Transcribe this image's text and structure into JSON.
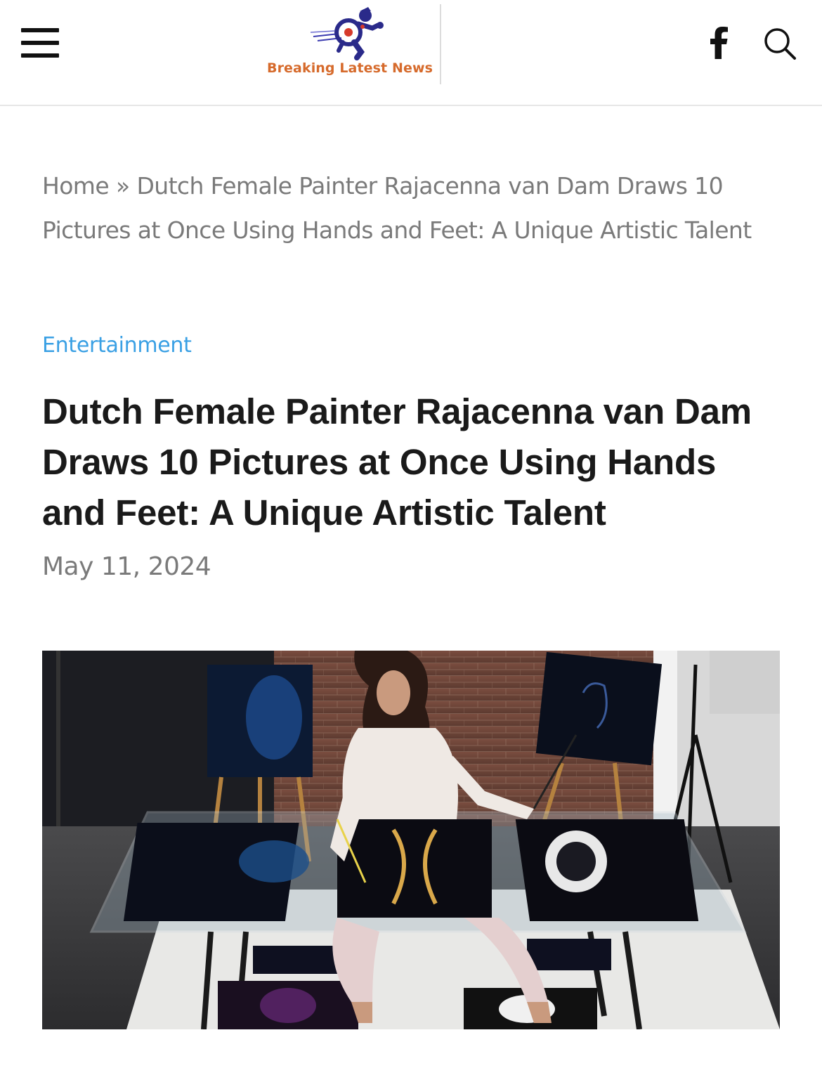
{
  "header": {
    "site_name": "Breaking Latest News",
    "menu_icon": "hamburger-menu-icon",
    "facebook_icon": "facebook-icon",
    "search_icon": "search-icon",
    "brand_color": "#d66a2b",
    "logo_color": "#2a2a8a"
  },
  "breadcrumb": {
    "home": "Home",
    "separator": "»",
    "current": "Dutch Female Painter Rajacenna van Dam Draws 10 Pictures at Once Using Hands and Feet: A Unique Artistic Talent"
  },
  "article": {
    "category": "Entertainment",
    "category_color": "#3aa0e4",
    "title": "Dutch Female Painter Rajacenna van Dam Draws 10 Pictures at Once Using Hands and Feet: A Unique Artistic Talent",
    "date": "May 11, 2024",
    "image_description_icon": "featured-photo"
  }
}
